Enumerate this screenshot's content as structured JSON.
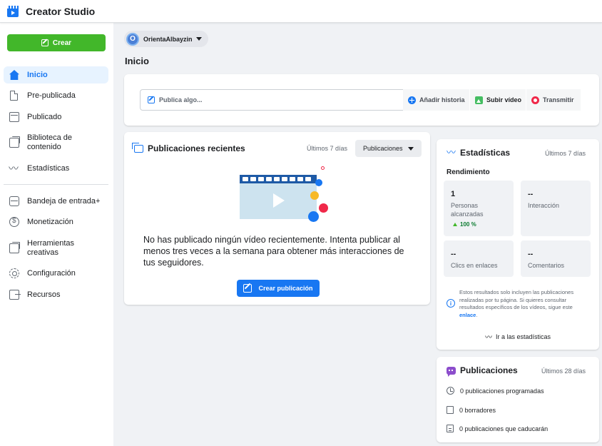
{
  "app": {
    "title": "Creator Studio"
  },
  "sidebar": {
    "create_label": "Crear",
    "items": [
      {
        "label": "Inicio",
        "icon": "home-icon"
      },
      {
        "label": "Pre-publicada",
        "icon": "document-icon"
      },
      {
        "label": "Publicado",
        "icon": "browser-icon"
      },
      {
        "label": "Biblioteca de contenido",
        "icon": "library-icon"
      },
      {
        "label": "Estadísticas",
        "icon": "insights-icon"
      },
      {
        "label": "Bandeja de entrada+",
        "icon": "inbox-icon"
      },
      {
        "label": "Monetización",
        "icon": "dollar-icon"
      },
      {
        "label": "Herramientas creativas",
        "icon": "tools-icon"
      },
      {
        "label": "Configuración",
        "icon": "gear-icon"
      },
      {
        "label": "Recursos",
        "icon": "exit-icon"
      }
    ]
  },
  "page_selector": {
    "avatar_letter": "O",
    "name": "OrientaAlbayzin"
  },
  "main": {
    "title": "Inicio",
    "composer": {
      "placeholder": "Publica algo...",
      "add_story": "Añadir historia",
      "upload_video": "Subir vídeo",
      "broadcast": "Transmitir"
    },
    "recent": {
      "title": "Publicaciones recientes",
      "range": "Últimos 7 días",
      "filter": "Publicaciones",
      "empty_message": "No has publicado ningún vídeo recientemente. Intenta publicar al menos tres veces a la semana para obtener más interacciones de tus seguidores.",
      "create_button": "Crear publicación"
    }
  },
  "stats": {
    "title": "Estadísticas",
    "range": "Últimos 7 días",
    "subtitle": "Rendimiento",
    "tiles": [
      {
        "value": "1",
        "label": "Personas alcanzadas",
        "delta": "100 %"
      },
      {
        "value": "--",
        "label": "Interacción"
      },
      {
        "value": "--",
        "label": "Clics en enlaces"
      },
      {
        "value": "--",
        "label": "Comentarios"
      }
    ],
    "note": "Estos resultados solo incluyen las publicaciones realizadas por tu página. Si quieres consultar resultados específicos de los vídeos, sigue este",
    "note_link": "enlace",
    "note_end": ".",
    "go_link": "Ir a las estadísticas"
  },
  "publications": {
    "title": "Publicaciones",
    "range": "Últimos 28 días",
    "rows": [
      {
        "label": "0 publicaciones programadas",
        "icon": "clock-icon"
      },
      {
        "label": "0 borradores",
        "icon": "document-icon"
      },
      {
        "label": "0 publicaciones que caducarán",
        "icon": "calendar-icon"
      }
    ]
  },
  "colors": {
    "accent": "#1877f2",
    "create_green": "#42b72a",
    "background": "#f0f2f5"
  }
}
